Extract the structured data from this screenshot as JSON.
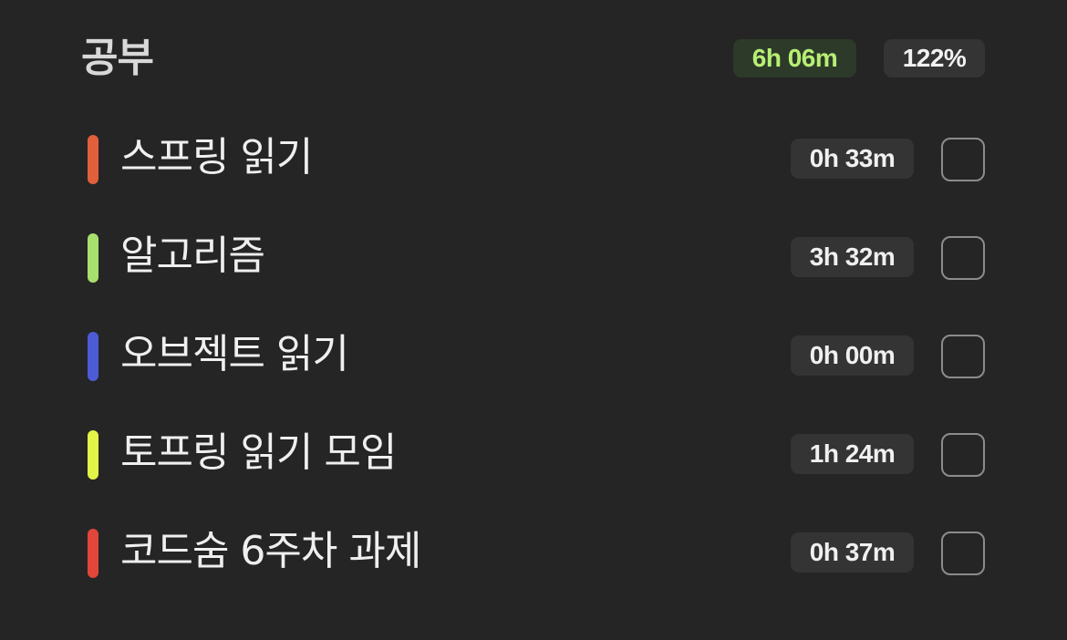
{
  "category": {
    "title": "공부",
    "total_time": "6h 06m",
    "percent": "122%",
    "total_time_color": "#b7ef73"
  },
  "tasks": [
    {
      "name": "스프링 읽기",
      "time": "0h 33m",
      "color": "#e0603c",
      "checked": false
    },
    {
      "name": "알고리즘",
      "time": "3h 32m",
      "color": "#a8e06e",
      "checked": false
    },
    {
      "name": "오브젝트 읽기",
      "time": "0h 00m",
      "color": "#4c5bd6",
      "checked": false
    },
    {
      "name": "토프링 읽기 모임",
      "time": "1h 24m",
      "color": "#e2f547",
      "checked": false
    },
    {
      "name": "코드숨 6주차 과제",
      "time": "0h 37m",
      "color": "#e2463a",
      "checked": false
    }
  ]
}
